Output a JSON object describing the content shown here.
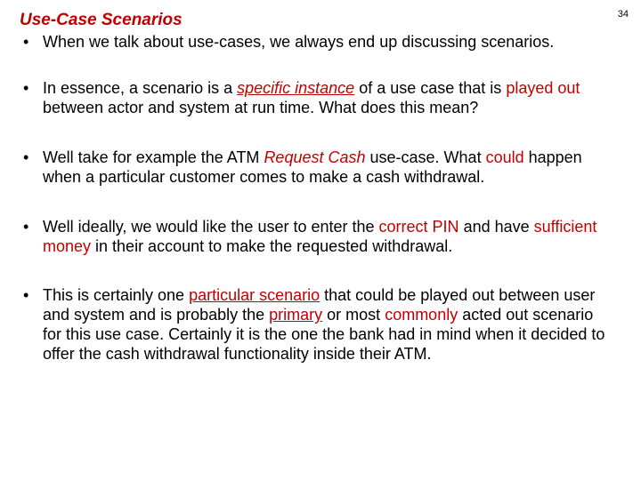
{
  "pageNumber": "34",
  "title": "Use-Case Scenarios",
  "bullets": [
    {
      "parts": [
        {
          "text": "When we talk about use-cases, we always end up discussing scenarios."
        }
      ]
    },
    {
      "parts": [
        {
          "text": "In essence, a scenario is a "
        },
        {
          "text": "specific instance",
          "cls": "red i u"
        },
        {
          "text": " of a use case that is "
        },
        {
          "text": "played out",
          "cls": "red"
        },
        {
          "text": " between actor and system at run time. What does this mean?"
        }
      ]
    },
    {
      "parts": [
        {
          "text": "Well take for example the ATM "
        },
        {
          "text": "Request Cash",
          "cls": "red i"
        },
        {
          "text": " use-case. What "
        },
        {
          "text": "could",
          "cls": "red"
        },
        {
          "text": " happen when a particular customer comes to make a cash withdrawal."
        }
      ]
    },
    {
      "parts": [
        {
          "text": "Well ideally, we would like the user to enter the "
        },
        {
          "text": "correct PIN",
          "cls": "red"
        },
        {
          "text": " and have "
        },
        {
          "text": "sufficient money",
          "cls": "red"
        },
        {
          "text": " in their account to make the requested withdrawal."
        }
      ]
    },
    {
      "parts": [
        {
          "text": "This is certainly one "
        },
        {
          "text": "particular scenario",
          "cls": "red u"
        },
        {
          "text": " that could be played out between user and system and is probably the "
        },
        {
          "text": "primary",
          "cls": "red u"
        },
        {
          "text": " or most "
        },
        {
          "text": "commonly",
          "cls": "red"
        },
        {
          "text": " acted out scenario for this use case. Certainly it is the one the bank had in mind when it decided to offer the cash withdrawal functionality inside their ATM."
        }
      ]
    }
  ]
}
